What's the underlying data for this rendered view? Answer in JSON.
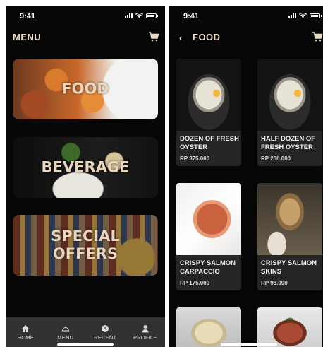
{
  "status_bar": {
    "time": "9:41"
  },
  "menu_screen": {
    "title": "MENU",
    "cards": [
      {
        "label": "FOOD"
      },
      {
        "label": "BEVERAGE"
      },
      {
        "label": "SPECIAL\nOFFERS"
      }
    ],
    "tabs": [
      {
        "label": "HOME",
        "icon": "home-icon"
      },
      {
        "label": "MENU",
        "icon": "menu-cloche-icon",
        "active": true
      },
      {
        "label": "RECENT",
        "icon": "recent-icon"
      },
      {
        "label": "PROFILE",
        "icon": "profile-icon"
      }
    ]
  },
  "food_screen": {
    "title": "FOOD",
    "products": [
      {
        "name": "DOZEN OF FRESH OYSTER",
        "price": "RP 375.000"
      },
      {
        "name": "HALF DOZEN OF FRESH OYSTER",
        "price": "RP 200.000"
      },
      {
        "name": "CRISPY SALMON CARPACCIO",
        "price": "RP 175.000"
      },
      {
        "name": "CRISPY SALMON SKINS",
        "price": "RP 98.000"
      }
    ]
  },
  "colors": {
    "background": "#060606",
    "accent_text": "#e8dcc4",
    "tab_bar": "#333231",
    "card": "#252525"
  }
}
